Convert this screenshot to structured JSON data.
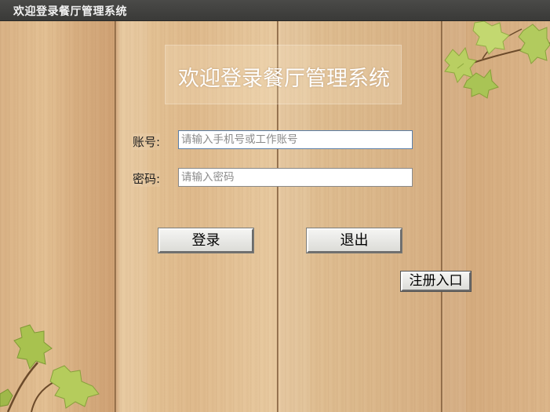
{
  "window": {
    "title": "欢迎登录餐厅管理系统"
  },
  "header": {
    "title": "欢迎登录餐厅管理系统"
  },
  "form": {
    "account": {
      "label": "账号:",
      "value": "",
      "placeholder": "请输入手机号或工作账号"
    },
    "password": {
      "label": "密码:",
      "value": "",
      "placeholder": "请输入密码"
    }
  },
  "buttons": {
    "login": "登录",
    "exit": "退出",
    "register": "注册入口"
  },
  "decorations": {
    "top_right": "vine-leaves-icon",
    "bottom_left": "vine-leaves-icon"
  }
}
